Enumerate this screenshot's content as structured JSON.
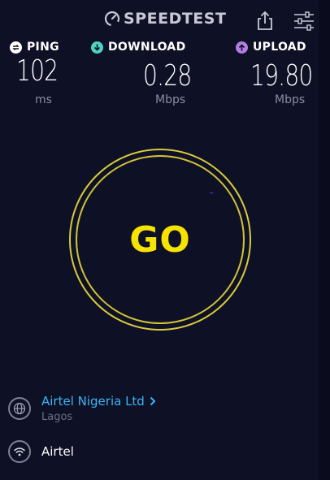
{
  "header": {
    "brand": "SPEEDTEST",
    "share_icon": "share-icon",
    "settings_icon": "settings-sliders-icon"
  },
  "metrics": {
    "ping": {
      "label": "PING",
      "value": "102",
      "unit": "ms",
      "icon": "ping-icon",
      "color": "#ffffff"
    },
    "download": {
      "label": "DOWNLOAD",
      "value": "0.28",
      "unit": "Mbps",
      "icon": "download-arrow-icon",
      "color": "#4fd2c2"
    },
    "upload": {
      "label": "UPLOAD",
      "value": "19.80",
      "unit": "Mbps",
      "icon": "upload-arrow-icon",
      "color": "#b57de0"
    }
  },
  "go_button": {
    "label": "GO",
    "color": "#f6e300"
  },
  "provider": {
    "name": "Airtel Nigeria Ltd",
    "city": "Lagos",
    "icon": "globe-icon",
    "link_color": "#3ab6f0"
  },
  "network": {
    "name": "Airtel",
    "icon": "wifi-icon"
  }
}
